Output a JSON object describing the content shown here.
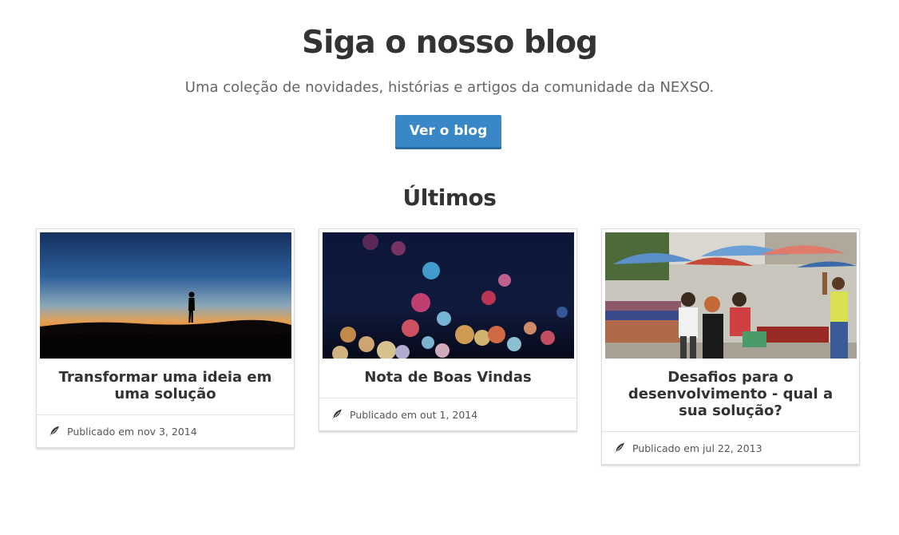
{
  "hero": {
    "title": "Siga o nosso blog",
    "subtitle": "Uma coleção de novidades, histórias e artigos da comunidade da NEXSO.",
    "button_label": "Ver o blog",
    "button_color": "#3a87c8"
  },
  "latest": {
    "heading": "Últimos",
    "posts": [
      {
        "title": "Transformar uma ideia em uma solução",
        "published": "Publicado em nov 3, 2014",
        "image": "sunset-silhouette-photo",
        "meta_icon": "feather-icon"
      },
      {
        "title": "Nota de Boas Vindas",
        "published": "Publicado em out 1, 2014",
        "image": "bokeh-city-lights-photo",
        "meta_icon": "feather-icon"
      },
      {
        "title": "Desafios para o desenvolvimento - qual a sua solução?",
        "published": "Publicado em jul 22, 2013",
        "image": "street-market-umbrellas-photo",
        "meta_icon": "feather-icon"
      }
    ]
  }
}
